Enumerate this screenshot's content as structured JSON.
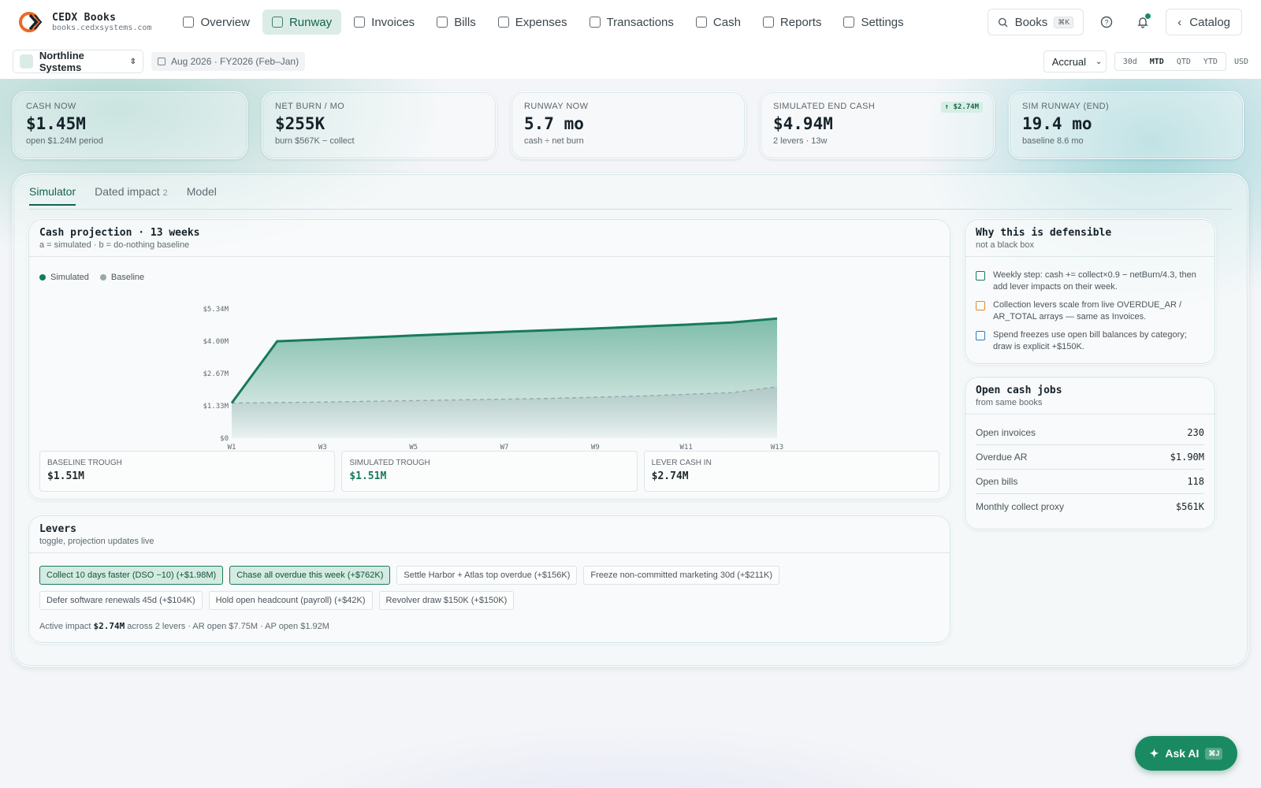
{
  "app": {
    "name": "CEDX Books",
    "url": "books.cedxsystems.com"
  },
  "nav": {
    "items": [
      {
        "label": "Overview",
        "icon": "grid-icon"
      },
      {
        "label": "Runway",
        "icon": "gauge-icon",
        "active": true
      },
      {
        "label": "Invoices",
        "icon": "invoice-icon"
      },
      {
        "label": "Bills",
        "icon": "dollar-circle-icon"
      },
      {
        "label": "Expenses",
        "icon": "wallet-icon"
      },
      {
        "label": "Transactions",
        "icon": "book-icon"
      },
      {
        "label": "Cash",
        "icon": "bank-icon"
      },
      {
        "label": "Reports",
        "icon": "bar-chart-icon"
      },
      {
        "label": "Settings",
        "icon": "sliders-icon"
      }
    ],
    "search_label": "Books",
    "search_kbd": "⌘K",
    "catalog_label": "Catalog"
  },
  "subbar": {
    "entity": "Northline Systems",
    "period": "Aug 2026 · FY2026 (Feb–Jan)",
    "basis": "Accrual",
    "ranges": [
      "30d",
      "MTD",
      "QTD",
      "YTD"
    ],
    "active_range": "MTD",
    "currency": "USD"
  },
  "kpis": [
    {
      "label": "Cash now",
      "value": "$1.45M",
      "sub": "open $1.24M period"
    },
    {
      "label": "Net burn / mo",
      "value": "$255K",
      "sub": "burn $567K − collect"
    },
    {
      "label": "Runway now",
      "value": "5.7 mo",
      "sub": "cash ÷ net burn"
    },
    {
      "label": "Simulated end cash",
      "value": "$4.94M",
      "sub": "2 levers · 13w",
      "badge": "↑ $2.74M"
    },
    {
      "label": "Sim runway (end)",
      "value": "19.4 mo",
      "sub": "baseline 8.6 mo"
    }
  ],
  "tabs": [
    {
      "label": "Simulator",
      "active": true
    },
    {
      "label": "Dated impact",
      "count": "2"
    },
    {
      "label": "Model"
    }
  ],
  "projection": {
    "title": "Cash projection · 13 weeks",
    "subtitle": "a = simulated · b = do-nothing baseline",
    "stats": [
      {
        "label": "Baseline trough",
        "value": "$1.51M"
      },
      {
        "label": "Simulated trough",
        "value": "$1.51M"
      },
      {
        "label": "Lever cash in",
        "value": "$2.74M"
      }
    ]
  },
  "chart_data": {
    "type": "area",
    "x": [
      "W1",
      "W2",
      "W3",
      "W4",
      "W5",
      "W6",
      "W7",
      "W8",
      "W9",
      "W10",
      "W11",
      "W12",
      "W13"
    ],
    "xticks": [
      "W1",
      "W3",
      "W5",
      "W7",
      "W9",
      "W11",
      "W13"
    ],
    "yticks": [
      "$0",
      "$1.33M",
      "$2.67M",
      "$4.00M",
      "$5.34M"
    ],
    "ylim": [
      0,
      5.34
    ],
    "series": [
      {
        "name": "Simulated",
        "color": "#177a5e",
        "values": [
          1.45,
          4.0,
          4.08,
          4.16,
          4.24,
          4.32,
          4.39,
          4.46,
          4.53,
          4.61,
          4.69,
          4.78,
          4.94
        ]
      },
      {
        "name": "Baseline",
        "color": "#9aa7ad",
        "values": [
          1.45,
          1.47,
          1.49,
          1.52,
          1.55,
          1.58,
          1.61,
          1.64,
          1.69,
          1.74,
          1.81,
          1.88,
          2.12
        ]
      }
    ]
  },
  "levers": {
    "title": "Levers",
    "subtitle": "toggle, projection updates live",
    "items": [
      {
        "label": "Collect 10 days faster (DSO −10) (+$1.98M)",
        "on": true
      },
      {
        "label": "Chase all overdue this week (+$762K)",
        "on": true
      },
      {
        "label": "Settle Harbor + Atlas top overdue (+$156K)",
        "on": false
      },
      {
        "label": "Freeze non-committed marketing 30d (+$211K)",
        "on": false
      },
      {
        "label": "Defer software renewals 45d (+$104K)",
        "on": false
      },
      {
        "label": "Hold open headcount (payroll) (+$42K)",
        "on": false
      },
      {
        "label": "Revolver draw $150K (+$150K)",
        "on": false
      }
    ],
    "active_prefix": "Active impact",
    "active_value": "$2.74M",
    "active_suffix": "across 2 levers · AR open $7.75M · AP open $1.92M"
  },
  "why": {
    "title": "Why this is defensible",
    "subtitle": "not a black box",
    "items": [
      {
        "text": "Weekly step: cash += collect×0.9 − netBurn/4.3, then add lever impacts on their week.",
        "icon": "calculator-icon",
        "color": "#177a5e"
      },
      {
        "text": "Collection levers scale from live OVERDUE_AR / AR_TOTAL arrays — same as Invoices.",
        "icon": "gauge-icon",
        "color": "#e08a2e"
      },
      {
        "text": "Spend freezes use open bill balances by category; draw is explicit +$150K.",
        "icon": "bank-icon",
        "color": "#2b7fc0"
      }
    ]
  },
  "jobs": {
    "title": "Open cash jobs",
    "subtitle": "from same books",
    "items": [
      {
        "label": "Open invoices",
        "value": "230"
      },
      {
        "label": "Overdue AR",
        "value": "$1.90M"
      },
      {
        "label": "Open bills",
        "value": "118"
      },
      {
        "label": "Monthly collect proxy",
        "value": "$561K"
      }
    ]
  },
  "ask_ai": {
    "label": "Ask AI",
    "kbd": "⌘J"
  }
}
